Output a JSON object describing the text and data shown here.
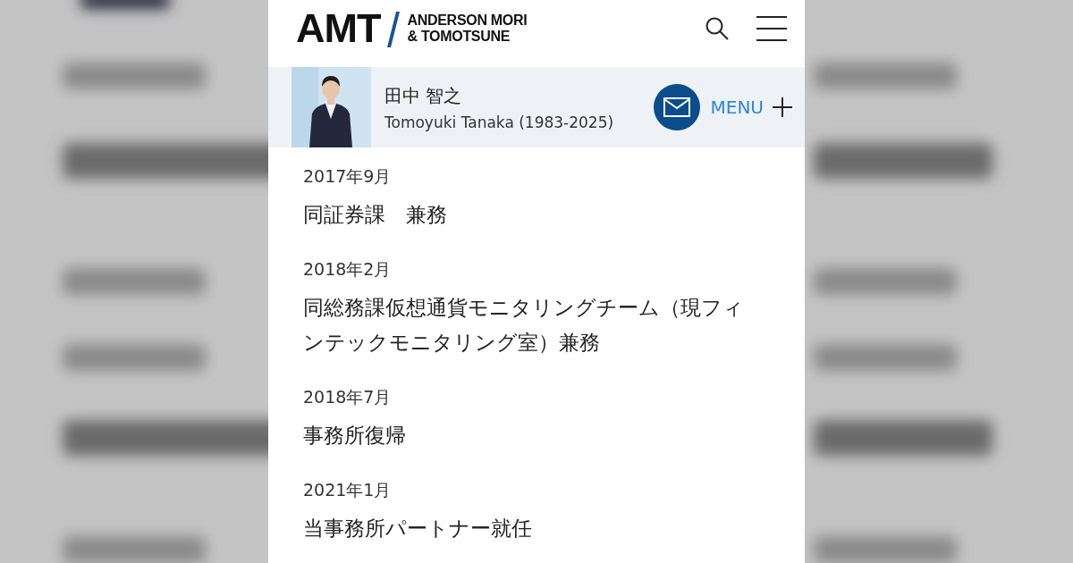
{
  "header": {
    "logo": {
      "mark": "AMT",
      "name_lines": [
        "ANDERSON MORI",
        "& TOMOTSUNE"
      ]
    }
  },
  "profile": {
    "name": "田中 智之",
    "romanized": "Tomoyuki Tanaka (1983-2025)",
    "menu_label": "MENU"
  },
  "career": [
    {
      "date": "2017年9月",
      "text": "同証券課　兼務"
    },
    {
      "date": "2018年2月",
      "text": "同総務課仮想通貨モニタリングチーム（現フィンテックモニタリング室）兼務"
    },
    {
      "date": "2018年7月",
      "text": "事務所復帰"
    },
    {
      "date": "2021年1月",
      "text": "当事務所パートナー就任"
    }
  ]
}
